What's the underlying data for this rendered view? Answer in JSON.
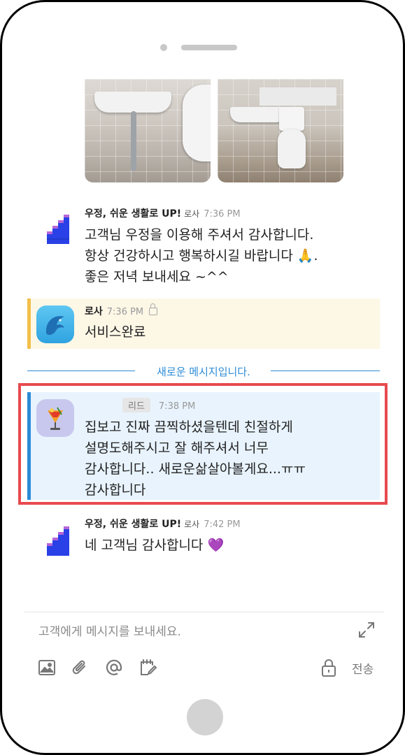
{
  "chat": {
    "messages": [
      {
        "sender": "우정, 쉬운 생활로 UP!",
        "role": "로사",
        "time": "7:36 PM",
        "text": "고객님 우정을 이용해 주셔서 감사합니다.\n항상 건강하시고 행복하시길 바랍니다 🙏.\n좋은 저녁 보내세요 ~^^"
      },
      {
        "sender": "로사",
        "time": "7:36 PM",
        "text": "서비스완료"
      },
      {
        "role": "리드",
        "time": "7:38 PM",
        "text": "집보고 진짜 끔찍하셨을텐데 친절하게\n설명도해주시고 잘 해주셔서 너무\n감사합니다.. 새로운삶살아볼게요...ㅠㅠ\n감사합니다"
      },
      {
        "sender": "우정, 쉬운 생활로 UP!",
        "role": "로사",
        "time": "7:42 PM",
        "text": "네 고객님 감사합니다 💜"
      }
    ],
    "new_messages_divider": "새로운 메시지입니다."
  },
  "composer": {
    "placeholder": "고객에게 메시지를 보내세요.",
    "send_label": "전송",
    "icons": [
      "image-icon",
      "paperclip-icon",
      "mention-icon",
      "edit-note-icon",
      "lock-icon",
      "expand-icon"
    ]
  },
  "colors": {
    "accent": "#2b8bd6",
    "highlight_border": "#e84a4f",
    "internal_note_bg": "#fdf7e6",
    "internal_note_bar": "#f2bf4a",
    "lead_bg": "#e8f3fd"
  }
}
